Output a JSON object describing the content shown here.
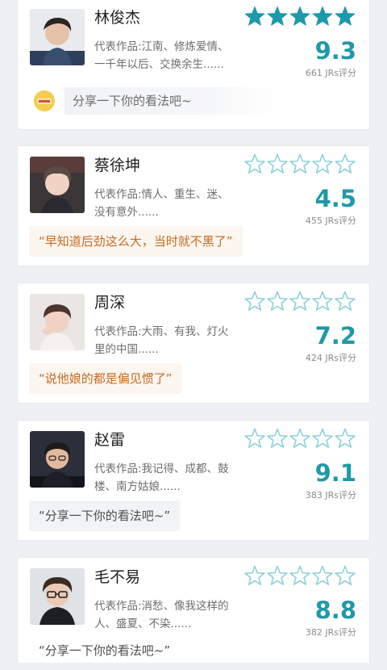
{
  "colors": {
    "accent": "#1f99a8",
    "star_filled": "#1c9aab",
    "star_outline": "#8fd0d9",
    "quote_text": "#c66a21",
    "quote_bg": "#fbf6ef"
  },
  "cards": [
    {
      "name": "林俊杰",
      "works_line1": "代表作品:江南、修炼爱情、",
      "works_line2": "一千年以后、交换余生......",
      "stars_filled": 5,
      "stars_total": 5,
      "score": "9.3",
      "count": "661 JRs评分",
      "comment": "分享一下你的看法吧~",
      "avatar_icon": "person-photo-icon"
    },
    {
      "name": "蔡徐坤",
      "works_line1": "代表作品:情人、重生、迷、",
      "works_line2": "没有意外......",
      "stars_filled": 0,
      "stars_total": 5,
      "score": "4.5",
      "count": "455 JRs评分",
      "comment": "“早知道后劲这么大，当时就不黑了”",
      "avatar_icon": "person-photo-icon"
    },
    {
      "name": "周深",
      "works_line1": "代表作品:大雨、有我、灯火",
      "works_line2": "里的中国......",
      "stars_filled": 0,
      "stars_total": 5,
      "score": "7.2",
      "count": "424 JRs评分",
      "comment": "“说他娘的都是偏见惯了”",
      "avatar_icon": "person-photo-icon"
    },
    {
      "name": "赵雷",
      "works_line1": "代表作品:我记得、成都、鼓",
      "works_line2": "楼、南方姑娘......",
      "stars_filled": 0,
      "stars_total": 5,
      "score": "9.1",
      "count": "383 JRs评分",
      "comment": "“分享一下你的看法吧~”",
      "avatar_icon": "person-photo-icon"
    },
    {
      "name": "毛不易",
      "works_line1": "代表作品:消愁、像我这样的",
      "works_line2": "人、盛夏、不染......",
      "stars_filled": 0,
      "stars_total": 5,
      "score": "8.8",
      "count": "382 JRs评分",
      "comment": "“分享一下你的看法吧~”",
      "avatar_icon": "person-photo-icon"
    }
  ]
}
